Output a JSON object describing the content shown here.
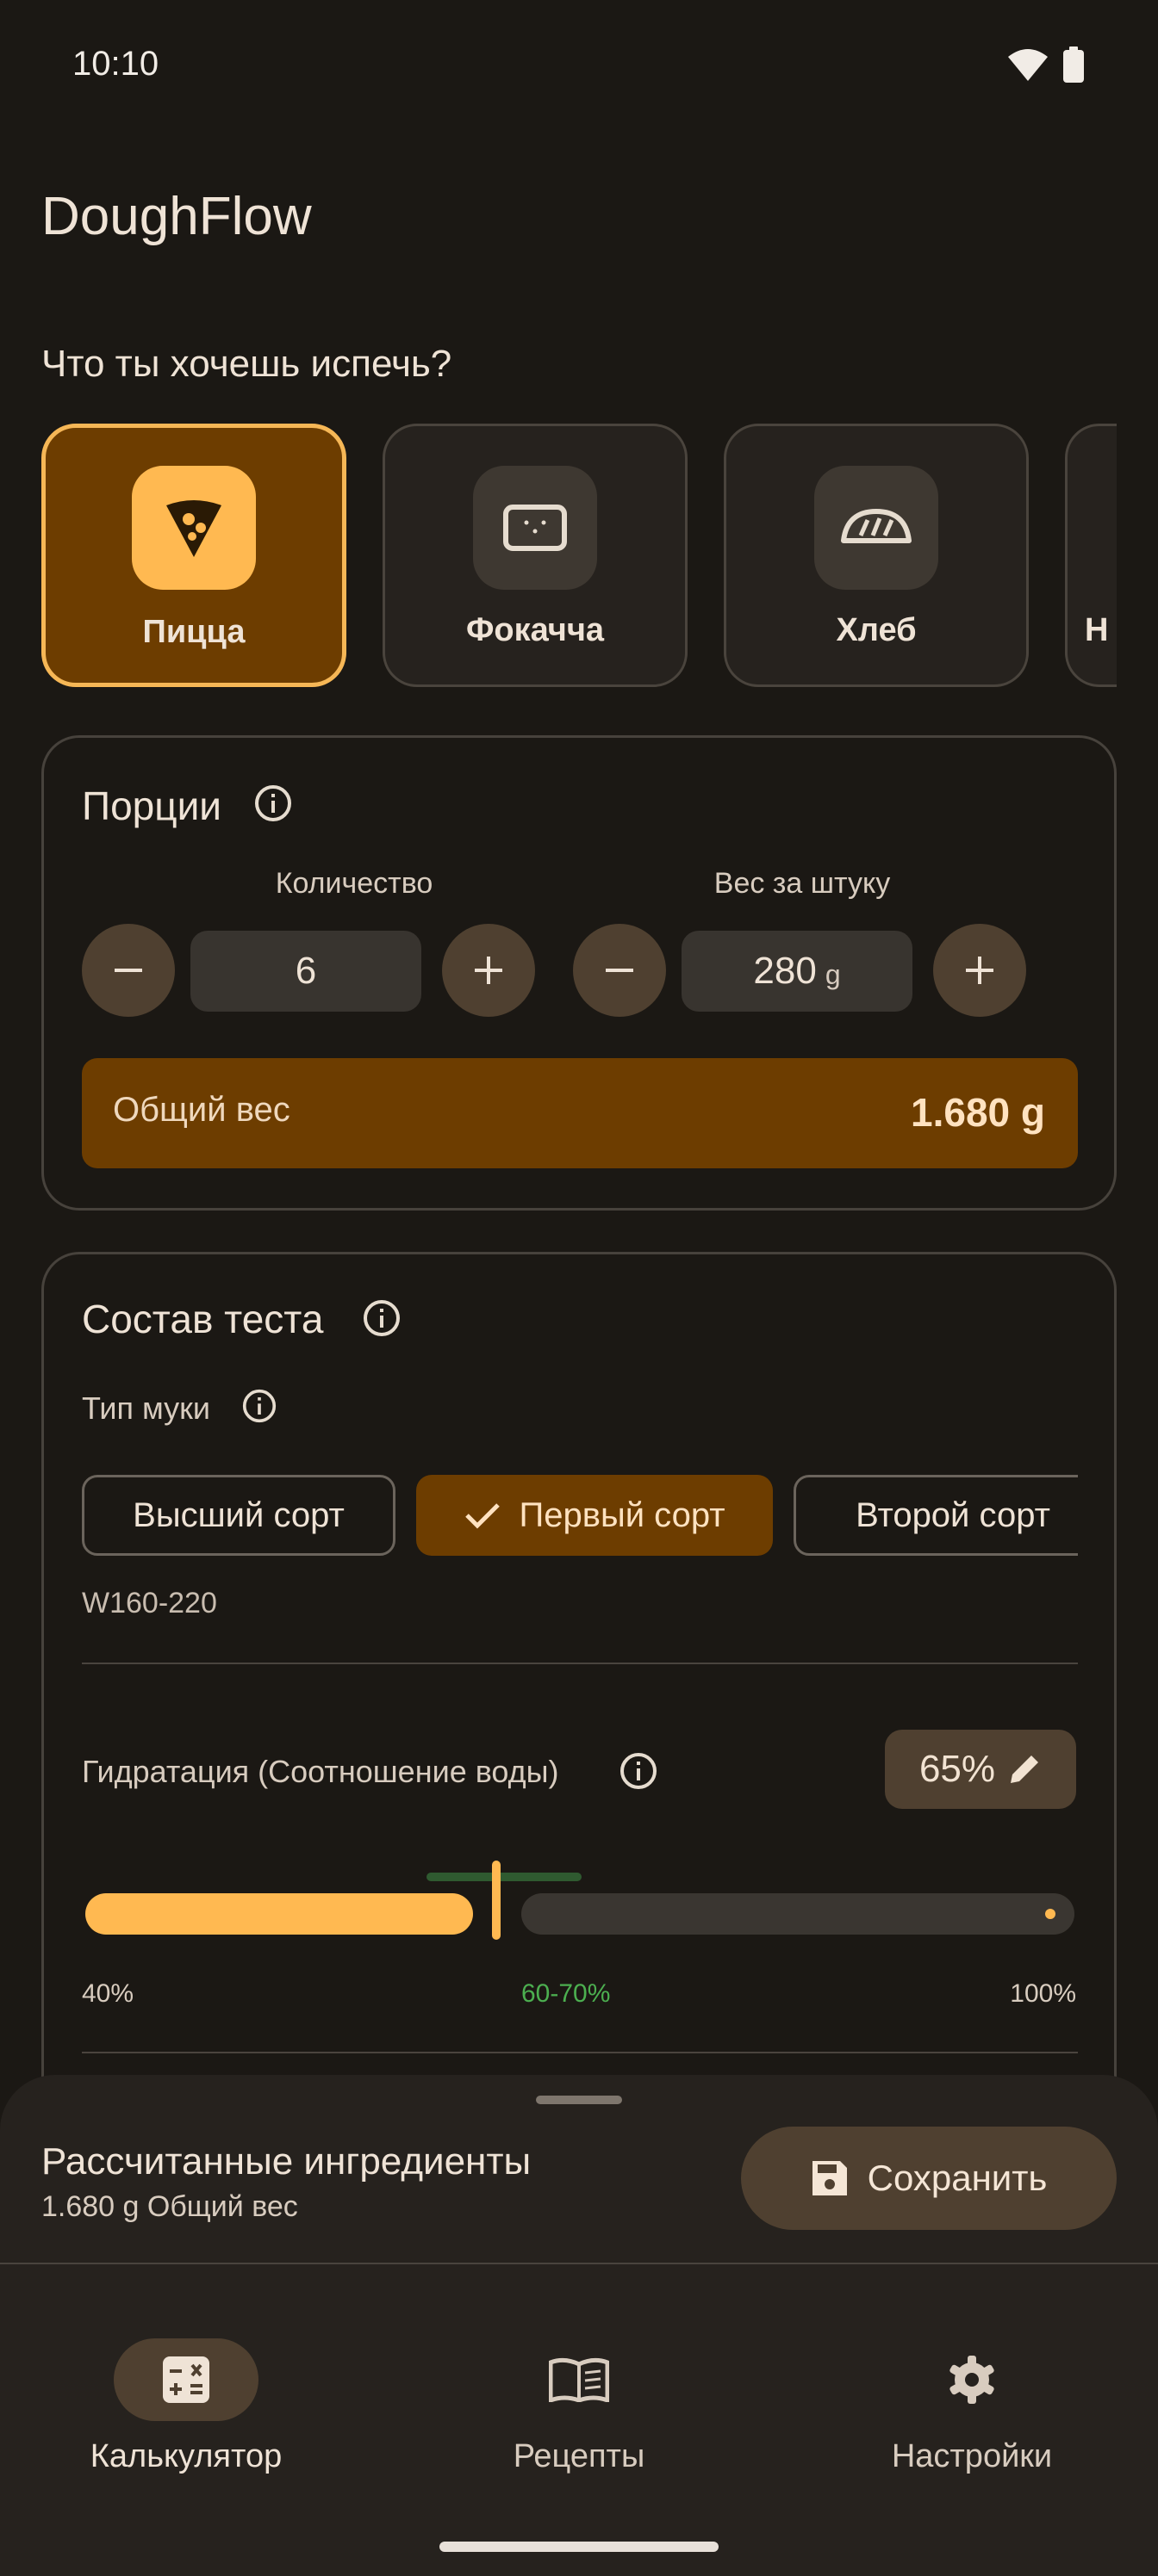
{
  "status_bar": {
    "time": "10:10"
  },
  "app": {
    "title": "DoughFlow"
  },
  "question": "Что ты хочешь испечь?",
  "categories": [
    {
      "label": "Пицца",
      "icon": "pizza-icon",
      "selected": true
    },
    {
      "label": "Фокачча",
      "icon": "focaccia-icon",
      "selected": false
    },
    {
      "label": "Хлеб",
      "icon": "bread-icon",
      "selected": false
    },
    {
      "label": "Н",
      "icon": "more-category-icon",
      "selected": false
    }
  ],
  "portions": {
    "title": "Порции",
    "quantity_label": "Количество",
    "quantity": "6",
    "weight_label": "Вес за штуку",
    "weight": "280",
    "weight_unit": "g",
    "total_label": "Общий вес",
    "total_value": "1.680 g"
  },
  "dough": {
    "title": "Состав теста",
    "flour_label": "Тип муки",
    "flour_options": [
      "Высший сорт",
      "Первый сорт",
      "Второй сорт"
    ],
    "flour_selected": "Первый сорт",
    "flour_strength": "W160-220",
    "hydration_label": "Гидратация (Соотношение воды)",
    "hydration_value": "65%",
    "hydration_percent": 65,
    "slider_min": "40%",
    "slider_range": "60-70%",
    "slider_max": "100%"
  },
  "sheet": {
    "title": "Рассчитанные ингредиенты",
    "subtitle": "1.680 g Общий вес",
    "save_label": "Сохранить"
  },
  "nav": [
    {
      "label": "Калькулятор",
      "icon": "calculator-icon",
      "active": true
    },
    {
      "label": "Рецепты",
      "icon": "book-icon",
      "active": false
    },
    {
      "label": "Настройки",
      "icon": "gear-icon",
      "active": false
    }
  ],
  "colors": {
    "background": "#1b1814",
    "accent": "#ffb951",
    "accent_dark": "#6d3d00",
    "range_green": "#4caf50"
  }
}
